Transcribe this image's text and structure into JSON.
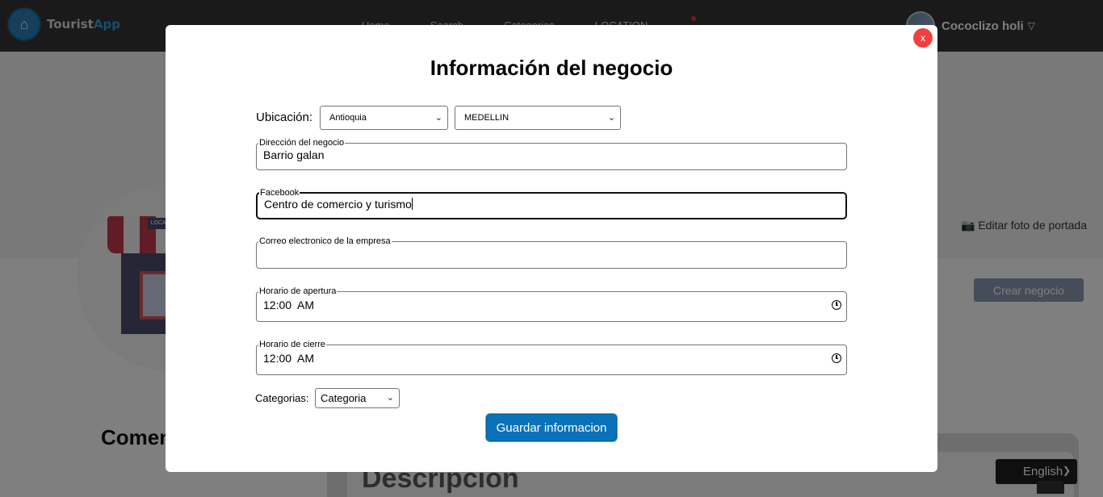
{
  "navbar": {
    "logo": {
      "text_main": "Tourist",
      "text_accent": "App"
    },
    "links": [
      "Home",
      "Search",
      "Categories",
      "LOCATION"
    ],
    "user": {
      "name": "Cococlizo holi",
      "caret": "▽"
    }
  },
  "page": {
    "edit_cover_label": "Editar foto de portada",
    "create_business_label": "Crear negocio",
    "comments_heading": "Comen",
    "description_heading": "Descripción",
    "store_sign": "LOCAL",
    "language_select": "English"
  },
  "modal": {
    "close_label": "x",
    "title": "Información del negocio",
    "location": {
      "label": "Ubicación:",
      "department": "Antioquia",
      "city": "MEDELLIN"
    },
    "fields": {
      "address": {
        "legend": "Dirección del negocio",
        "value": "Barrio galan"
      },
      "facebook": {
        "legend": "Facebook",
        "value": "Centro de comercio y turismo"
      },
      "email": {
        "legend": "Correo electronico de la empresa",
        "value": ""
      },
      "opening": {
        "legend": "Horario de apertura",
        "value": "12:00  AM"
      },
      "closing": {
        "legend": "Horario de cierre",
        "value": "12:00  AM"
      }
    },
    "categories": {
      "label": "Categorias:",
      "selected": "Categoria"
    },
    "save_label": "Guardar informacion"
  },
  "colors": {
    "navbar_bg": "#343434",
    "primary_button": "#0a72b8",
    "close_button": "#f0413f",
    "overlay": "rgba(0,0,0,0.5)"
  },
  "icons": {
    "camera": "camera-icon",
    "clock": "clock-icon",
    "chevron": "chevron-down-icon"
  }
}
